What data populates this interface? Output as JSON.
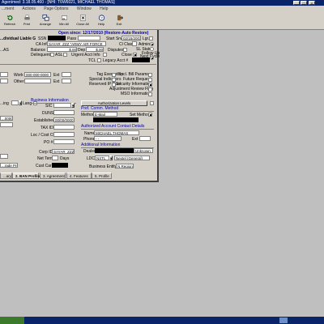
{
  "window": {
    "title": "Agentmed: 3.18.05.460 - [NHI: T6W6021, MICHAEL THOMAS]",
    "controls": [
      "_",
      "□",
      "×"
    ]
  },
  "menu": [
    "...ment",
    "Actions",
    "Page Options",
    "Window",
    "Help"
  ],
  "toolbar": [
    {
      "label": "Refresh",
      "icon": "refresh-icon"
    },
    {
      "label": "Print",
      "icon": "printer-icon"
    },
    {
      "label": "Arrange",
      "icon": "arrange-icon"
    },
    {
      "label": "Min All",
      "icon": "minimize-all-icon"
    },
    {
      "label": "Close All",
      "icon": "close-all-icon"
    },
    {
      "label": "Help",
      "icon": "help-icon"
    },
    {
      "label": "Exit",
      "icon": "exit-icon"
    }
  ],
  "account": {
    "banner": "Open since: 12/17/2010 (Restore-Auto Restore)",
    "ssn_label": "SSN",
    "pass_label": "Pass",
    "start_label": "Start Srv",
    "start_value": "02/15/2003",
    "lgr_label": "Lgr.",
    "ca_label": "CA Info",
    "ca_value": "SAYAR_ZZZ \"ARMY AIR FORCE",
    "cl_label": "Cl Class",
    "admin_label": "Admin",
    "sl_label": "SL Status",
    "balance_label": "Balance",
    "balance_value": "$.00",
    "dep_label": "Dep",
    "dep_value": "$.00",
    "disputes_label": "Disputes",
    "followup_label": "Follow Up",
    "delinquent_label": "Delinquent",
    "asl_label": "ASL",
    "urgent_label": "Urgent Acct Info",
    "close_label": "Close",
    "next_cycle_label": "Next Cycle",
    "tcl_label": "TCL",
    "legacy_label": "Legacy Acct #",
    "liable_label": "...dividual Liable G",
    "as_label": "...AS"
  },
  "contact": {
    "work_label": "Work",
    "work_value": "000-000-0000",
    "ext_label": "Ext",
    "other_label": "Other",
    "other_value": "",
    "lang_label": "...ing",
    "lang_button": "Lang",
    "flags": [
      {
        "label": "Tag Exemption",
        "checked": false
      },
      {
        "label": "Special Indicators",
        "checked": false
      },
      {
        "label": "Reserved IP Pool",
        "checked": false
      }
    ],
    "flags2": [
      {
        "label": "Spcl. Bill Params",
        "checked": false
      },
      {
        "label": "Future Request",
        "checked": false
      },
      {
        "label": "Security Information",
        "checked": true
      },
      {
        "label": "Adjustment Review Flag",
        "checked": false
      },
      {
        "label": "MSO Information",
        "checked": false
      }
    ]
  },
  "business": {
    "header": "Business Information",
    "sic_label": "SIC",
    "duns_label": "DUNS",
    "established_label": "Established",
    "established_value": "00/00/0000",
    "taxid_label": "TAX ID",
    "loc_label": "Loc / Cost Ctr",
    "po_label": "PO #",
    "corpid_label": "Corp ID",
    "corpid_value": "SAYAR_ZZZ",
    "net_terms_label": "Net Terms",
    "days_label": "Days",
    "cust_care_label": "Cust Care",
    "partial_value_1": "...0000",
    "partial_value_2": "...rade Pro"
  },
  "right": {
    "auth_label": "Authorization Levels",
    "pref_header": "Pref. Comm. Method",
    "method_label": "Method",
    "method_value": "E-Mail",
    "set_method_label": "Set Method",
    "auth_contact_header": "Authorized Account Contact Details",
    "name_label": "Name",
    "name_value": "MICHAEL THOMAS",
    "phone_label": "Phone",
    "phone_value": "- -",
    "ext_label": "Ext",
    "additional_header": "Additional Information",
    "dealer_label": "Dealer",
    "dealer_value": "Unknown",
    "ldc_label": "LDC",
    "ldc_value": "NXTL",
    "ldc_desc": "Nextel (General)",
    "business_entity_label": "Business Entity",
    "business_entity_value": "N Region"
  },
  "tabs": [
    {
      "label": "...ary",
      "active": false
    },
    {
      "label": "2. BAN Profile",
      "active": true
    },
    {
      "label": "3. Agreement",
      "active": false
    },
    {
      "label": "4. Features",
      "active": false
    },
    {
      "label": "5. Profile",
      "active": false
    }
  ]
}
